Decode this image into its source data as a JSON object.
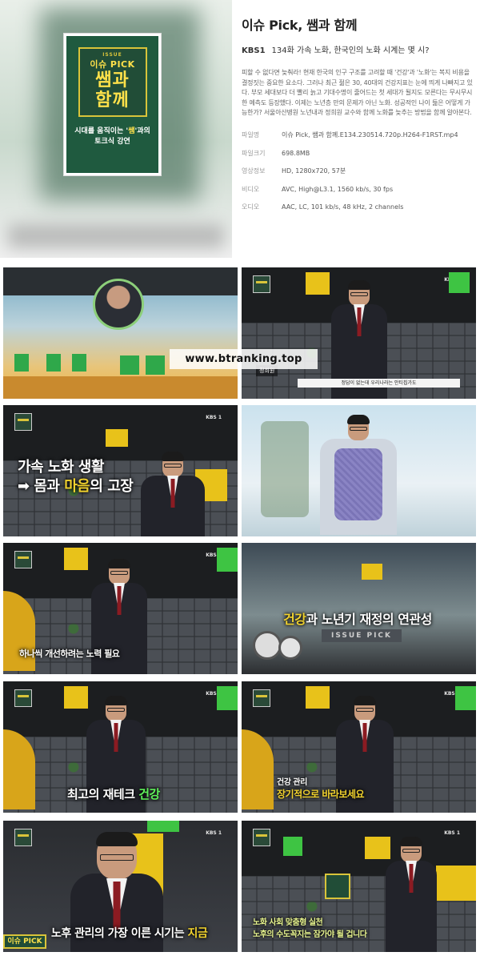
{
  "header": {
    "title": "이슈 Pick, 쌤과 함께",
    "network": "KBS1",
    "episode": "134화 가속 노화, 한국인의 노화 시계는 몇 시?",
    "description": "피할 수 없다면 늦춰라! 현재 한국의 인구 구조를 고려할 때 '건강'과 '노화'는 복지 비용을 결정짓는 중요한 요소다. 그러나 최근 젊은 30, 40대의 건강지표는 눈에 띄게 나빠지고 있다. 부모 세대보다 더 빨리 늙고 기대수명이 줄어드는 첫 세대가 될지도 모른다는 무시무시한 예측도 등장했다. 이제는 노년층 만의 문제가 아닌 노화. 성공적인 나이 듦은 어떻게 가능한가? 서울아산병원 노년내과 정희원 교수와 함께 노화를 늦추는 방법을 함께 알아본다.",
    "specs": [
      {
        "key": "파일명",
        "value": "이슈 Pick, 쌤과 함께.E134.230514.720p.H264-F1RST.mp4"
      },
      {
        "key": "파일크기",
        "value": "698.8MB"
      },
      {
        "key": "영상정보",
        "value": "HD, 1280x720, 57분"
      },
      {
        "key": "비디오",
        "value": "AVC, High@L3.1, 1560 kb/s, 30 fps"
      },
      {
        "key": "오디오",
        "value": "AAC, LC, 101 kb/s, 48 kHz, 2 channels"
      }
    ]
  },
  "poster": {
    "issue": "ISSUE",
    "pick": "이슈 PICK",
    "title_line1": "쌤과",
    "title_line2": "함께",
    "sub_line1_a": "시대를 움직이는 '",
    "sub_line1_hl": "쌤",
    "sub_line1_b": "'과의",
    "sub_line2": "토크식 강연"
  },
  "watermark": "www.btranking.top",
  "screens": {
    "kbs_tag": "KBS 1",
    "s2_name": "정희원",
    "s2_strip": "정답이 없는데 우리나라는 안티칩가도",
    "s3_line1": "가속 노화 생활",
    "s3_line2_pre": "➡ 몸",
    "s3_line2_mid": "과 ",
    "s3_line2_y": "마음",
    "s3_line2_post": "의 고장",
    "s5_caption": "하나씩 개선하려는 노력 필요",
    "s6_caption_a": "건강",
    "s6_caption_b": "과 노년기 재정",
    "s6_caption_c": "의 연관성",
    "s6_stage": "ISSUE PICK",
    "s7_caption_a": "최고의 재테크 ",
    "s7_caption_b": "건강",
    "s8_line1": "건강 관리",
    "s8_line2": "장기적으로 바라보세요",
    "s9_caption_a": "노후 관리",
    "s9_caption_b": "의 가장 이른 시기는 ",
    "s9_caption_c": "지금",
    "s9_tag": "이슈 PICK",
    "s10_line1": "노화 사회 맞춤형 실천",
    "s10_line2": "노후의 수도꼭지는 잠가야 될 겁니다"
  }
}
